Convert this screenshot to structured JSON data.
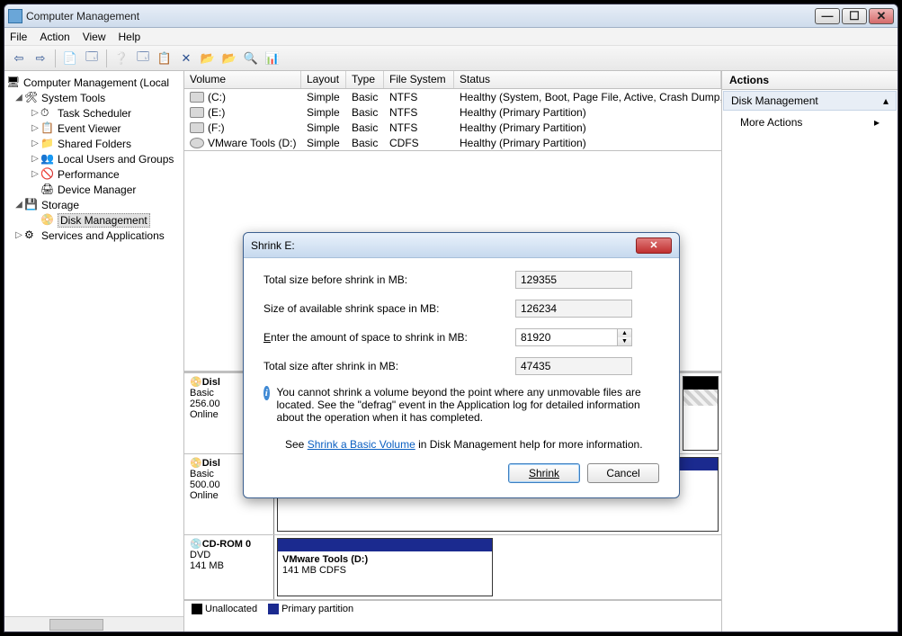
{
  "titlebar": {
    "title": "Computer Management"
  },
  "menus": {
    "file": "File",
    "action": "Action",
    "view": "View",
    "help": "Help"
  },
  "tree": {
    "root": "Computer Management (Local",
    "system_tools": "System Tools",
    "task_scheduler": "Task Scheduler",
    "event_viewer": "Event Viewer",
    "shared_folders": "Shared Folders",
    "local_users": "Local Users and Groups",
    "performance": "Performance",
    "device_manager": "Device Manager",
    "storage": "Storage",
    "disk_management": "Disk Management",
    "services": "Services and Applications"
  },
  "vol_hdr": {
    "volume": "Volume",
    "layout": "Layout",
    "type": "Type",
    "fs": "File System",
    "status": "Status"
  },
  "vols": [
    {
      "name": "(C:)",
      "layout": "Simple",
      "type": "Basic",
      "fs": "NTFS",
      "status": "Healthy (System, Boot, Page File, Active, Crash Dump, Pri"
    },
    {
      "name": "(E:)",
      "layout": "Simple",
      "type": "Basic",
      "fs": "NTFS",
      "status": "Healthy (Primary Partition)"
    },
    {
      "name": "(F:)",
      "layout": "Simple",
      "type": "Basic",
      "fs": "NTFS",
      "status": "Healthy (Primary Partition)"
    },
    {
      "name": "VMware Tools (D:)",
      "layout": "Simple",
      "type": "Basic",
      "fs": "CDFS",
      "status": "Healthy (Primary Partition)"
    }
  ],
  "disks": {
    "d0": {
      "name": "Disl",
      "type": "Basic",
      "size": "256.00",
      "status": "Online"
    },
    "d1": {
      "name": "Disl",
      "type": "Basic",
      "size": "500.00",
      "status": "Online"
    },
    "cd": {
      "name": "CD-ROM 0",
      "type": "DVD",
      "size": "141 MB"
    },
    "cd_part_name": "VMware Tools  (D:)",
    "cd_part_info": "141 MB CDFS"
  },
  "legend": {
    "unalloc": "Unallocated",
    "primary": "Primary partition"
  },
  "actions": {
    "header": "Actions",
    "disk_mgmt": "Disk Management",
    "more": "More Actions"
  },
  "dialog": {
    "title": "Shrink E:",
    "before_label": "Total size before shrink in MB:",
    "before_value": "129355",
    "avail_label": "Size of available shrink space in MB:",
    "avail_value": "126234",
    "enter_label": "Enter the amount of space to shrink in MB:",
    "enter_value": "81920",
    "after_label": "Total size after shrink in MB:",
    "after_value": "47435",
    "info": "You cannot shrink a volume beyond the point where any unmovable files are located. See the \"defrag\" event in the Application log for detailed information about the operation when it has completed.",
    "see_prefix": "See ",
    "link": "Shrink a Basic Volume",
    "see_suffix": " in Disk Management help for more information.",
    "shrink_btn": "Shrink",
    "cancel_btn": "Cancel"
  }
}
